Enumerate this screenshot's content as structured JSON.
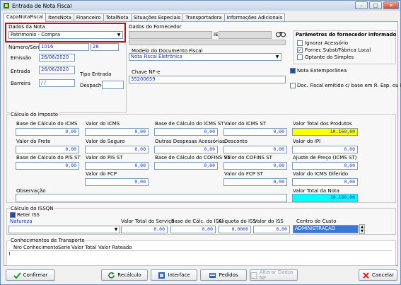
{
  "window": {
    "title": "Entrada de Nota Fiscal"
  },
  "tabs": [
    "CapaNotaFiscal",
    "ItensNota",
    "Financeiro",
    "TotalNota",
    "Situações Especiais",
    "Transportadora",
    "Informações Adicionais"
  ],
  "dados_nota": {
    "group": "Dados da Nota",
    "tipo": "Patrimonio - Compra",
    "numero_serie_label": "Número/Série",
    "numero": "1016",
    "serie": "26",
    "emissao_label": "Emissão",
    "emissao": "26/06/2020",
    "entrada_label": "Entrada",
    "entrada": "26/06/2020",
    "tipo_entrada_label": "Tipo Entrada",
    "barreira_label": "Barreira",
    "barreira": "/ /",
    "despacho_label": "Despacho"
  },
  "fornecedor": {
    "group": "Dados do Fornecedor",
    "ie_label": "IE",
    "modelo_label": "Modelo do Documento Fiscal",
    "modelo": "Nota Fiscal Eletrônica",
    "chave_label": "Chave NF-e",
    "chave": "35200659",
    "extemporanea_label": "Nota Extemporânea",
    "doc_fiscal_label": "Doc. Fiscal emitido c/ base em R. Esp. ou N. E."
  },
  "parametros": {
    "title": "Parâmetros do fornecedor informado",
    "items": [
      {
        "label": "Ignorar Acessório",
        "checked": false
      },
      {
        "label": "Fornec.Subst/Fábrica Local",
        "checked": true
      },
      {
        "label": "Optante do Simples",
        "checked": false
      }
    ]
  },
  "imposto": {
    "group": "Cálculo do Imposto",
    "row1": [
      {
        "label": "Base de Cálculo do ICMS",
        "value": "0,00"
      },
      {
        "label": "Valor do  ICMS",
        "value": "0,00"
      },
      {
        "label": "Base de Cálculo do ICMS ST",
        "value": "0,00"
      },
      {
        "label": "Valor do ICMS ST",
        "value": "0,00"
      },
      {
        "label": "Valor Total  dos Produtos",
        "value": "10.160,00"
      }
    ],
    "row2": [
      {
        "label": "Valor do Frete",
        "value": "0,00"
      },
      {
        "label": "Valor do Seguro",
        "value": "0,00"
      },
      {
        "label": "Outras Despesas Acessórias",
        "value": "0,00"
      },
      {
        "label": "Desconto",
        "value": "0,00"
      },
      {
        "label": "Valor do IPI",
        "value": "0,00"
      }
    ],
    "row3": [
      {
        "label": "Base de Cálculo do PIS ST",
        "value": "0,00"
      },
      {
        "label": "Valor do PIS ST",
        "value": "0,00"
      },
      {
        "label": "Base de Cálculo do COFINS ST",
        "value": "0,00"
      },
      {
        "label": "Valor do COFINS ST",
        "value": "0,00"
      },
      {
        "label": "Ajuste de Preço (ICMS ST)",
        "value": "0,00"
      }
    ],
    "row4": [
      {
        "label": "Valor do  FCP",
        "value": "0,00"
      },
      {
        "label": "Valor do FCP ST",
        "value": "0,00"
      },
      {
        "label": "Valor do ICMS Diferido",
        "value": "0,00"
      }
    ],
    "observacao_label": "Observação",
    "total_nota_label": "Valor Total da Nota",
    "total_nota": "10.160,00"
  },
  "issqn": {
    "group": "Cálculo do ISSQN",
    "reter_label": "Reter ISS",
    "natureza_label": "Natureza",
    "servico_label": "Valor Total do Serviço",
    "servico": "0,00",
    "base_label": "Base de Cálc. do ISS",
    "base": "0,00",
    "aliquota_label": "Aliquota do ISS",
    "aliquota": "0,0000",
    "valor_label": "Valor do ISS",
    "valor": "0,00",
    "centro_label": "Centro de Custo",
    "centro": "ADMINISTRAÇÃO"
  },
  "conhecimentos": {
    "group": "Conhecimentos de Transporte",
    "columns": [
      "Nro Conhecimento",
      "Serie",
      "Valor Total",
      "Valor Rateado"
    ]
  },
  "buttons": {
    "confirmar": "Confirmar",
    "recalculo": "Recálculo",
    "interface": "Interface",
    "pedidos": "Pedidos",
    "alterar": "Alterar Dados NF",
    "cancelar": "Cancelar"
  },
  "colors": {
    "highlight_border": "#e00000",
    "yellow": "#ffff00",
    "cyan": "#00ffff",
    "select": "#3a78d8"
  }
}
